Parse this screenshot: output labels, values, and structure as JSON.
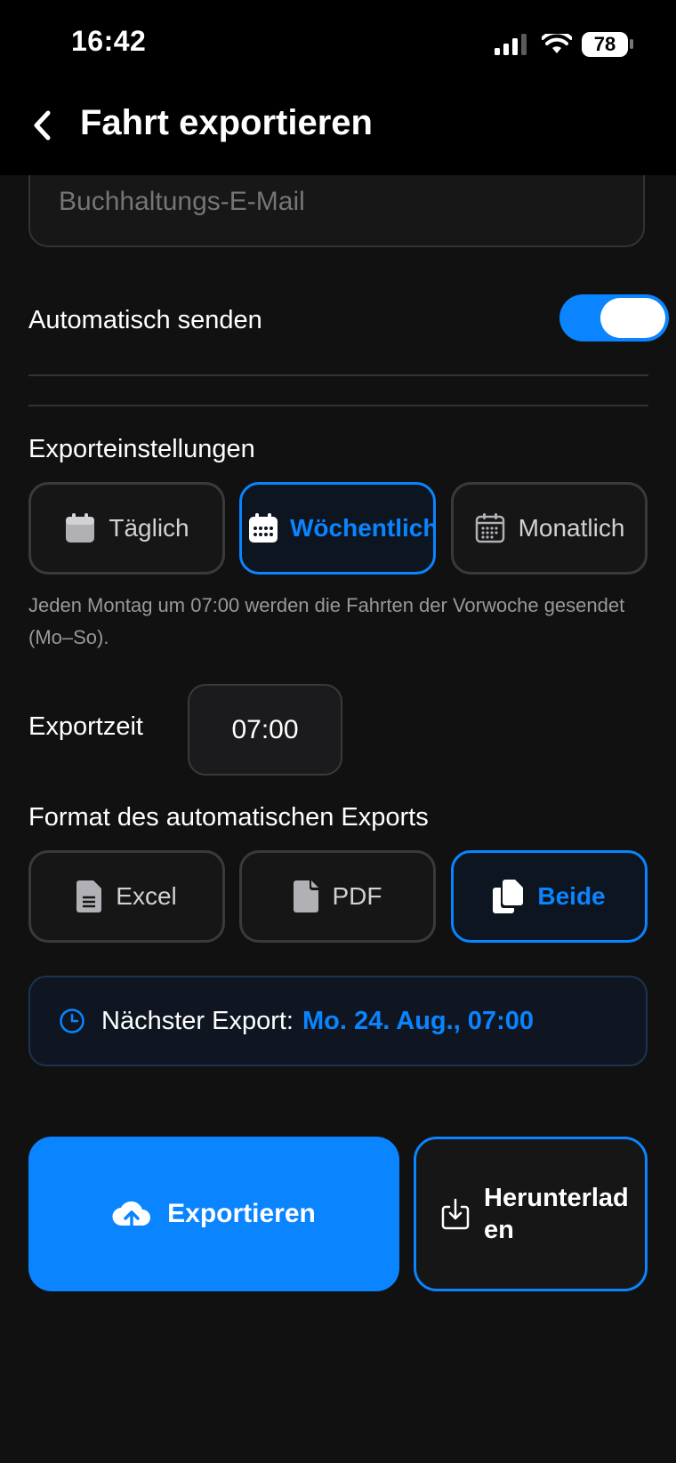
{
  "status_bar": {
    "time": "16:42",
    "battery": "78"
  },
  "header": {
    "title": "Fahrt exportieren"
  },
  "email": {
    "placeholder": "Buchhaltungs-E-Mail"
  },
  "auto_send": {
    "label": "Automatisch senden",
    "enabled": true
  },
  "export_settings": {
    "label": "Exporteinstellungen",
    "options": [
      {
        "label": "Täglich",
        "icon": "calendar-day-icon"
      },
      {
        "label": "Wöchentlich",
        "icon": "calendar-week-icon"
      },
      {
        "label": "Monatlich",
        "icon": "calendar-month-icon"
      }
    ],
    "selected": "Wöchentlich",
    "hint": "Jeden Montag um 07:00 werden die Fahrten der Vorwoche gesendet (Mo–So)."
  },
  "export_time": {
    "label": "Exportzeit",
    "value": "07:00"
  },
  "format": {
    "label": "Format des automatischen Exports",
    "options": [
      {
        "label": "Excel",
        "icon": "document-icon"
      },
      {
        "label": "PDF",
        "icon": "file-icon"
      },
      {
        "label": "Beide",
        "icon": "copy-icon"
      }
    ],
    "selected": "Beide"
  },
  "next_export": {
    "prefix": "Nächster Export:",
    "value": "Mo. 24. Aug., 07:00"
  },
  "actions": {
    "export_label": "Exportieren",
    "download_label": "Herunterladen"
  },
  "colors": {
    "accent": "#0a84ff",
    "background": "#111111"
  }
}
